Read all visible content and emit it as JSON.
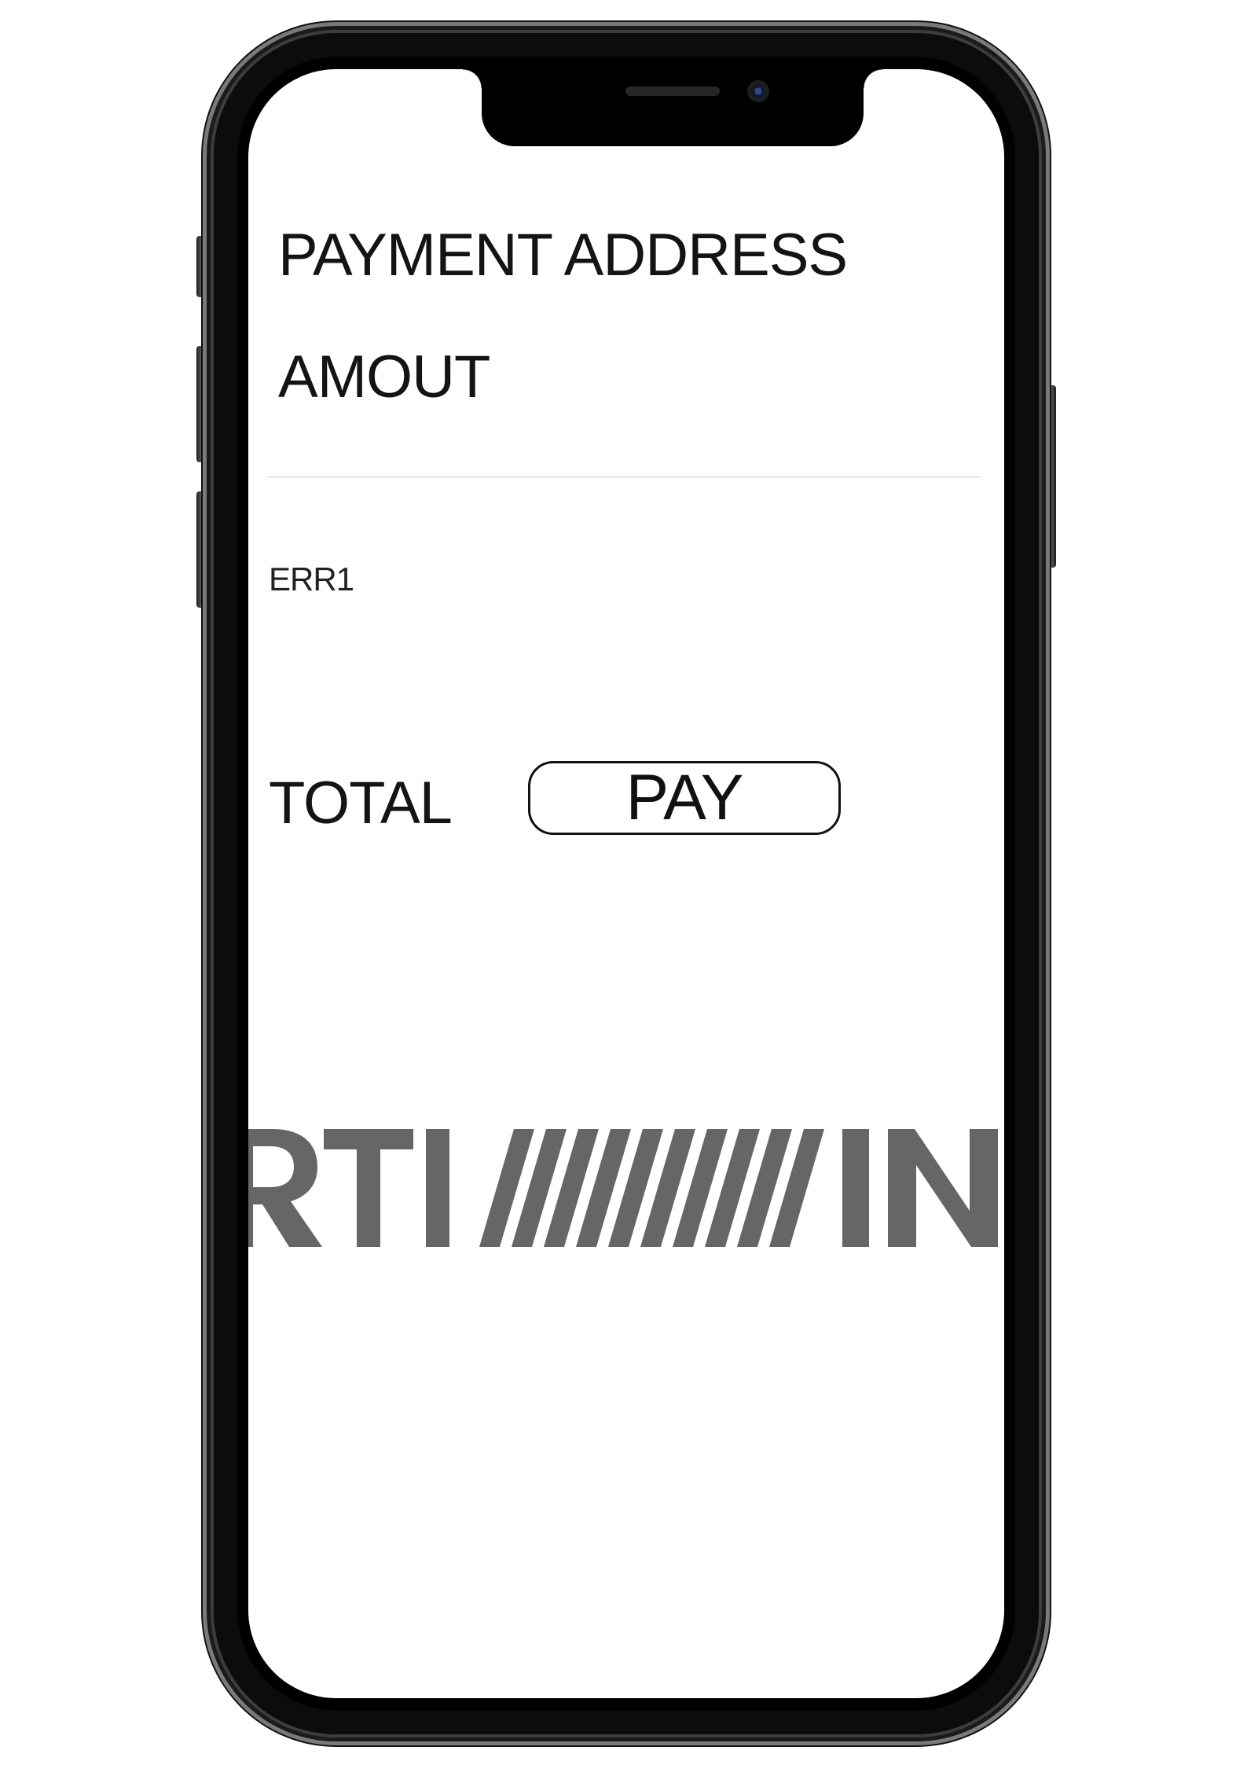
{
  "form": {
    "payment_address_label": "PAYMENT ADDRESS",
    "amount_label": "AMOUT",
    "error_text": "ERR1",
    "total_label": "TOTAL",
    "pay_button_label": "PAY"
  },
  "logo": {
    "text": "RTI//////////IN",
    "color": "#666666"
  }
}
